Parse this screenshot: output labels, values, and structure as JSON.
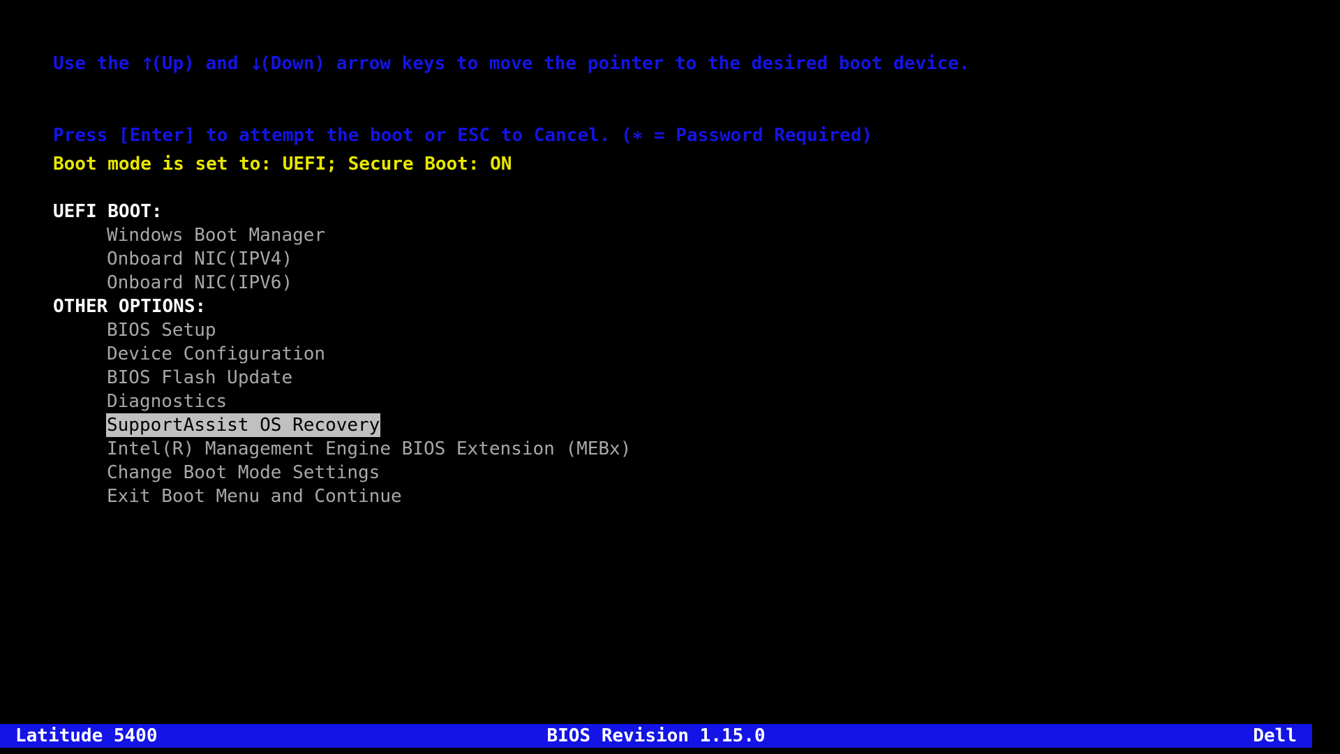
{
  "screen": {
    "background_color": "#000000",
    "accent_blue": "#1414E6",
    "status_yellow": "#E8E800",
    "header_white": "#FFFFFF",
    "item_gray": "#A8A8A8",
    "highlight_bg": "#C0C0C0",
    "highlight_fg": "#000000"
  },
  "instructions": {
    "line1_before_up": "Use the ",
    "up_arrow": "↑",
    "line1_mid": "(Up) and ",
    "down_arrow": "↓",
    "line1_after_down": "(Down) arrow keys to move the pointer to the desired boot device.",
    "line2": "Press [Enter] to attempt the boot or ESC to Cancel. (∗ = Password Required)"
  },
  "boot_mode": {
    "text": "Boot mode is set to: UEFI; Secure Boot: ON",
    "mode": "UEFI",
    "secure_boot": "ON"
  },
  "menu": {
    "groups": [
      {
        "header": "UEFI BOOT:",
        "items": [
          {
            "label": "Windows Boot Manager",
            "selected": false
          },
          {
            "label": "Onboard NIC(IPV4)",
            "selected": false
          },
          {
            "label": "Onboard NIC(IPV6)",
            "selected": false
          }
        ]
      },
      {
        "header": "OTHER OPTIONS:",
        "items": [
          {
            "label": "BIOS Setup",
            "selected": false
          },
          {
            "label": "Device Configuration",
            "selected": false
          },
          {
            "label": "BIOS Flash Update",
            "selected": false
          },
          {
            "label": "Diagnostics",
            "selected": false
          },
          {
            "label": "SupportAssist OS Recovery",
            "selected": true
          },
          {
            "label": "Intel(R) Management Engine BIOS Extension (MEBx)",
            "selected": false
          },
          {
            "label": "Change Boot Mode Settings",
            "selected": false
          },
          {
            "label": "Exit Boot Menu and Continue",
            "selected": false
          }
        ]
      }
    ]
  },
  "status_bar": {
    "model": "Latitude 5400",
    "bios_revision": "BIOS Revision 1.15.0",
    "vendor": "Dell"
  }
}
